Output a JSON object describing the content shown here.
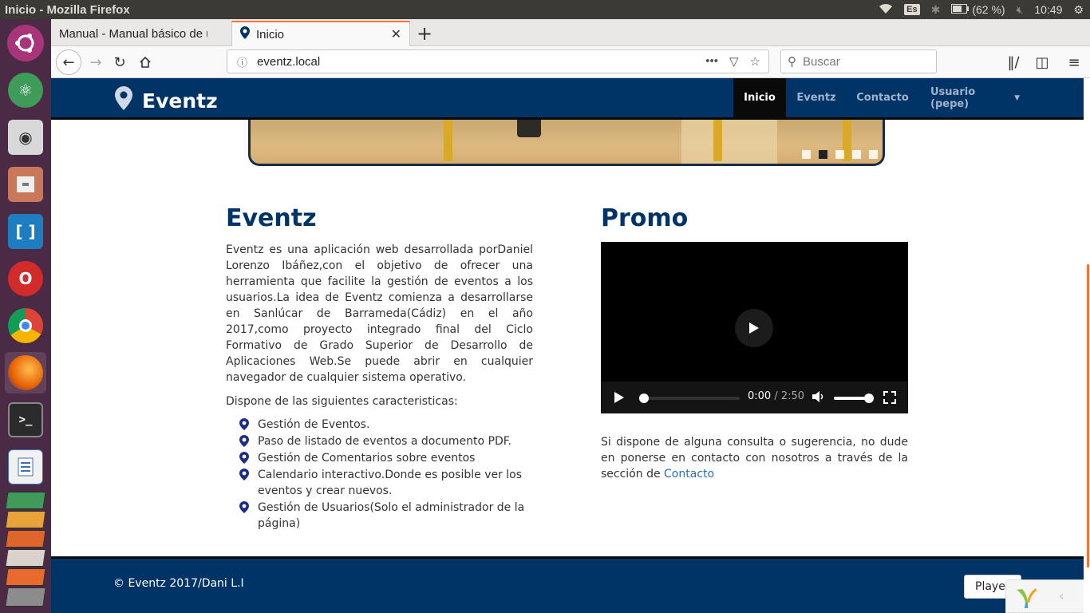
{
  "os": {
    "window_title": "Inicio - Mozilla Firefox",
    "keyboard": "Es",
    "battery": "(62 %)",
    "clock": "10:49"
  },
  "browser": {
    "tabs": [
      {
        "label": "Manual - Manual básico de u"
      },
      {
        "label": "Inicio"
      }
    ],
    "url": "eventz.local",
    "search_placeholder": "Buscar"
  },
  "site": {
    "brand": "Eventz",
    "menu": [
      {
        "label": "Inicio",
        "active": true
      },
      {
        "label": "Eventz"
      },
      {
        "label": "Contacto"
      },
      {
        "label": "Usuario (pepe)"
      }
    ],
    "carousel": {
      "slide_count": 5,
      "active_index": 1
    },
    "about": {
      "title": "Eventz",
      "paragraph": "Eventz es una aplicación web desarrollada porDaniel Lorenzo Ibáñez,con el objetivo de ofrecer una herramienta que facilite la gestión de eventos a los usuarios.La idea de Eventz comienza a desarrollarse en Sanlúcar de Barrameda(Cádiz) en el año 2017,como proyecto integrado final del Ciclo Formativo de Grado Superior de Desarrollo de Aplicaciones Web.Se puede abrir en cualquier navegador de cualquier sistema operativo.",
      "features_intro": "Dispone de las siguientes caracteristicas:",
      "features": [
        "Gestión de Eventos.",
        "Paso de listado de eventos a documento PDF.",
        "Gestión de Comentarios sobre eventos",
        "Calendario interactivo.Donde es posible ver los eventos y crear nuevos.",
        "Gestión de Usuarios(Solo el administrador de la página)"
      ]
    },
    "promo": {
      "title": "Promo",
      "video": {
        "current_time": "0:00",
        "duration": "2:50",
        "progress": 0,
        "volume": 1.0
      },
      "contact_text": "Si dispone de alguna consulta o sugerencia, no dude en ponerse en contacto con nosotros a través de la sección de ",
      "contact_link": "Contacto"
    },
    "footer": {
      "copyright": "© Eventz 2017/Dani L.I"
    },
    "player_button": "Player"
  },
  "colors": {
    "brand_navy": "#003366",
    "link": "#2a6db5",
    "firefox_accent": "#ff7139",
    "launcher": "#4b2a45"
  }
}
